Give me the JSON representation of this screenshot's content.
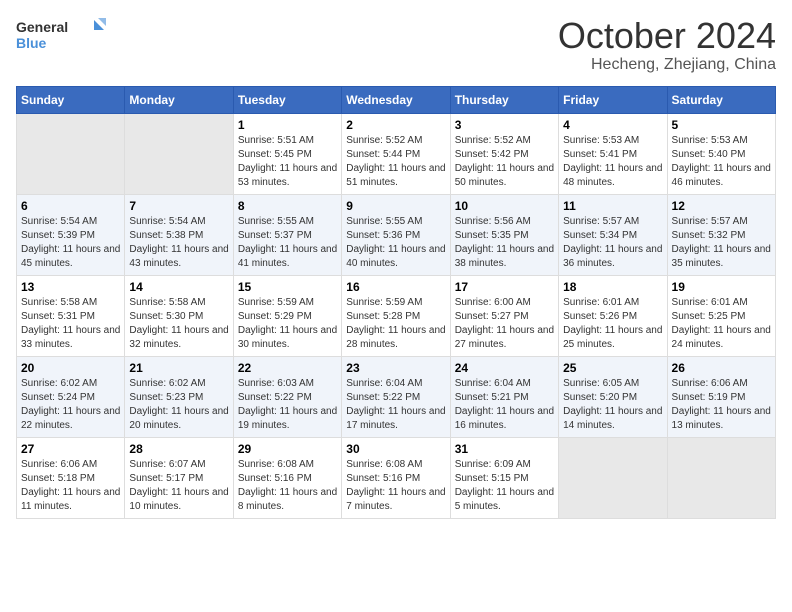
{
  "logo": {
    "line1": "General",
    "line2": "Blue"
  },
  "title": "October 2024",
  "subtitle": "Hecheng, Zhejiang, China",
  "days_of_week": [
    "Sunday",
    "Monday",
    "Tuesday",
    "Wednesday",
    "Thursday",
    "Friday",
    "Saturday"
  ],
  "weeks": [
    [
      {
        "day": "",
        "empty": true
      },
      {
        "day": "",
        "empty": true
      },
      {
        "day": "1",
        "sunrise": "5:51 AM",
        "sunset": "5:45 PM",
        "daylight": "11 hours and 53 minutes."
      },
      {
        "day": "2",
        "sunrise": "5:52 AM",
        "sunset": "5:44 PM",
        "daylight": "11 hours and 51 minutes."
      },
      {
        "day": "3",
        "sunrise": "5:52 AM",
        "sunset": "5:42 PM",
        "daylight": "11 hours and 50 minutes."
      },
      {
        "day": "4",
        "sunrise": "5:53 AM",
        "sunset": "5:41 PM",
        "daylight": "11 hours and 48 minutes."
      },
      {
        "day": "5",
        "sunrise": "5:53 AM",
        "sunset": "5:40 PM",
        "daylight": "11 hours and 46 minutes."
      }
    ],
    [
      {
        "day": "6",
        "sunrise": "5:54 AM",
        "sunset": "5:39 PM",
        "daylight": "11 hours and 45 minutes."
      },
      {
        "day": "7",
        "sunrise": "5:54 AM",
        "sunset": "5:38 PM",
        "daylight": "11 hours and 43 minutes."
      },
      {
        "day": "8",
        "sunrise": "5:55 AM",
        "sunset": "5:37 PM",
        "daylight": "11 hours and 41 minutes."
      },
      {
        "day": "9",
        "sunrise": "5:55 AM",
        "sunset": "5:36 PM",
        "daylight": "11 hours and 40 minutes."
      },
      {
        "day": "10",
        "sunrise": "5:56 AM",
        "sunset": "5:35 PM",
        "daylight": "11 hours and 38 minutes."
      },
      {
        "day": "11",
        "sunrise": "5:57 AM",
        "sunset": "5:34 PM",
        "daylight": "11 hours and 36 minutes."
      },
      {
        "day": "12",
        "sunrise": "5:57 AM",
        "sunset": "5:32 PM",
        "daylight": "11 hours and 35 minutes."
      }
    ],
    [
      {
        "day": "13",
        "sunrise": "5:58 AM",
        "sunset": "5:31 PM",
        "daylight": "11 hours and 33 minutes."
      },
      {
        "day": "14",
        "sunrise": "5:58 AM",
        "sunset": "5:30 PM",
        "daylight": "11 hours and 32 minutes."
      },
      {
        "day": "15",
        "sunrise": "5:59 AM",
        "sunset": "5:29 PM",
        "daylight": "11 hours and 30 minutes."
      },
      {
        "day": "16",
        "sunrise": "5:59 AM",
        "sunset": "5:28 PM",
        "daylight": "11 hours and 28 minutes."
      },
      {
        "day": "17",
        "sunrise": "6:00 AM",
        "sunset": "5:27 PM",
        "daylight": "11 hours and 27 minutes."
      },
      {
        "day": "18",
        "sunrise": "6:01 AM",
        "sunset": "5:26 PM",
        "daylight": "11 hours and 25 minutes."
      },
      {
        "day": "19",
        "sunrise": "6:01 AM",
        "sunset": "5:25 PM",
        "daylight": "11 hours and 24 minutes."
      }
    ],
    [
      {
        "day": "20",
        "sunrise": "6:02 AM",
        "sunset": "5:24 PM",
        "daylight": "11 hours and 22 minutes."
      },
      {
        "day": "21",
        "sunrise": "6:02 AM",
        "sunset": "5:23 PM",
        "daylight": "11 hours and 20 minutes."
      },
      {
        "day": "22",
        "sunrise": "6:03 AM",
        "sunset": "5:22 PM",
        "daylight": "11 hours and 19 minutes."
      },
      {
        "day": "23",
        "sunrise": "6:04 AM",
        "sunset": "5:22 PM",
        "daylight": "11 hours and 17 minutes."
      },
      {
        "day": "24",
        "sunrise": "6:04 AM",
        "sunset": "5:21 PM",
        "daylight": "11 hours and 16 minutes."
      },
      {
        "day": "25",
        "sunrise": "6:05 AM",
        "sunset": "5:20 PM",
        "daylight": "11 hours and 14 minutes."
      },
      {
        "day": "26",
        "sunrise": "6:06 AM",
        "sunset": "5:19 PM",
        "daylight": "11 hours and 13 minutes."
      }
    ],
    [
      {
        "day": "27",
        "sunrise": "6:06 AM",
        "sunset": "5:18 PM",
        "daylight": "11 hours and 11 minutes."
      },
      {
        "day": "28",
        "sunrise": "6:07 AM",
        "sunset": "5:17 PM",
        "daylight": "11 hours and 10 minutes."
      },
      {
        "day": "29",
        "sunrise": "6:08 AM",
        "sunset": "5:16 PM",
        "daylight": "11 hours and 8 minutes."
      },
      {
        "day": "30",
        "sunrise": "6:08 AM",
        "sunset": "5:16 PM",
        "daylight": "11 hours and 7 minutes."
      },
      {
        "day": "31",
        "sunrise": "6:09 AM",
        "sunset": "5:15 PM",
        "daylight": "11 hours and 5 minutes."
      },
      {
        "day": "",
        "empty": true
      },
      {
        "day": "",
        "empty": true
      }
    ]
  ],
  "labels": {
    "sunrise_prefix": "Sunrise: ",
    "sunset_prefix": "Sunset: ",
    "daylight_prefix": "Daylight: "
  }
}
